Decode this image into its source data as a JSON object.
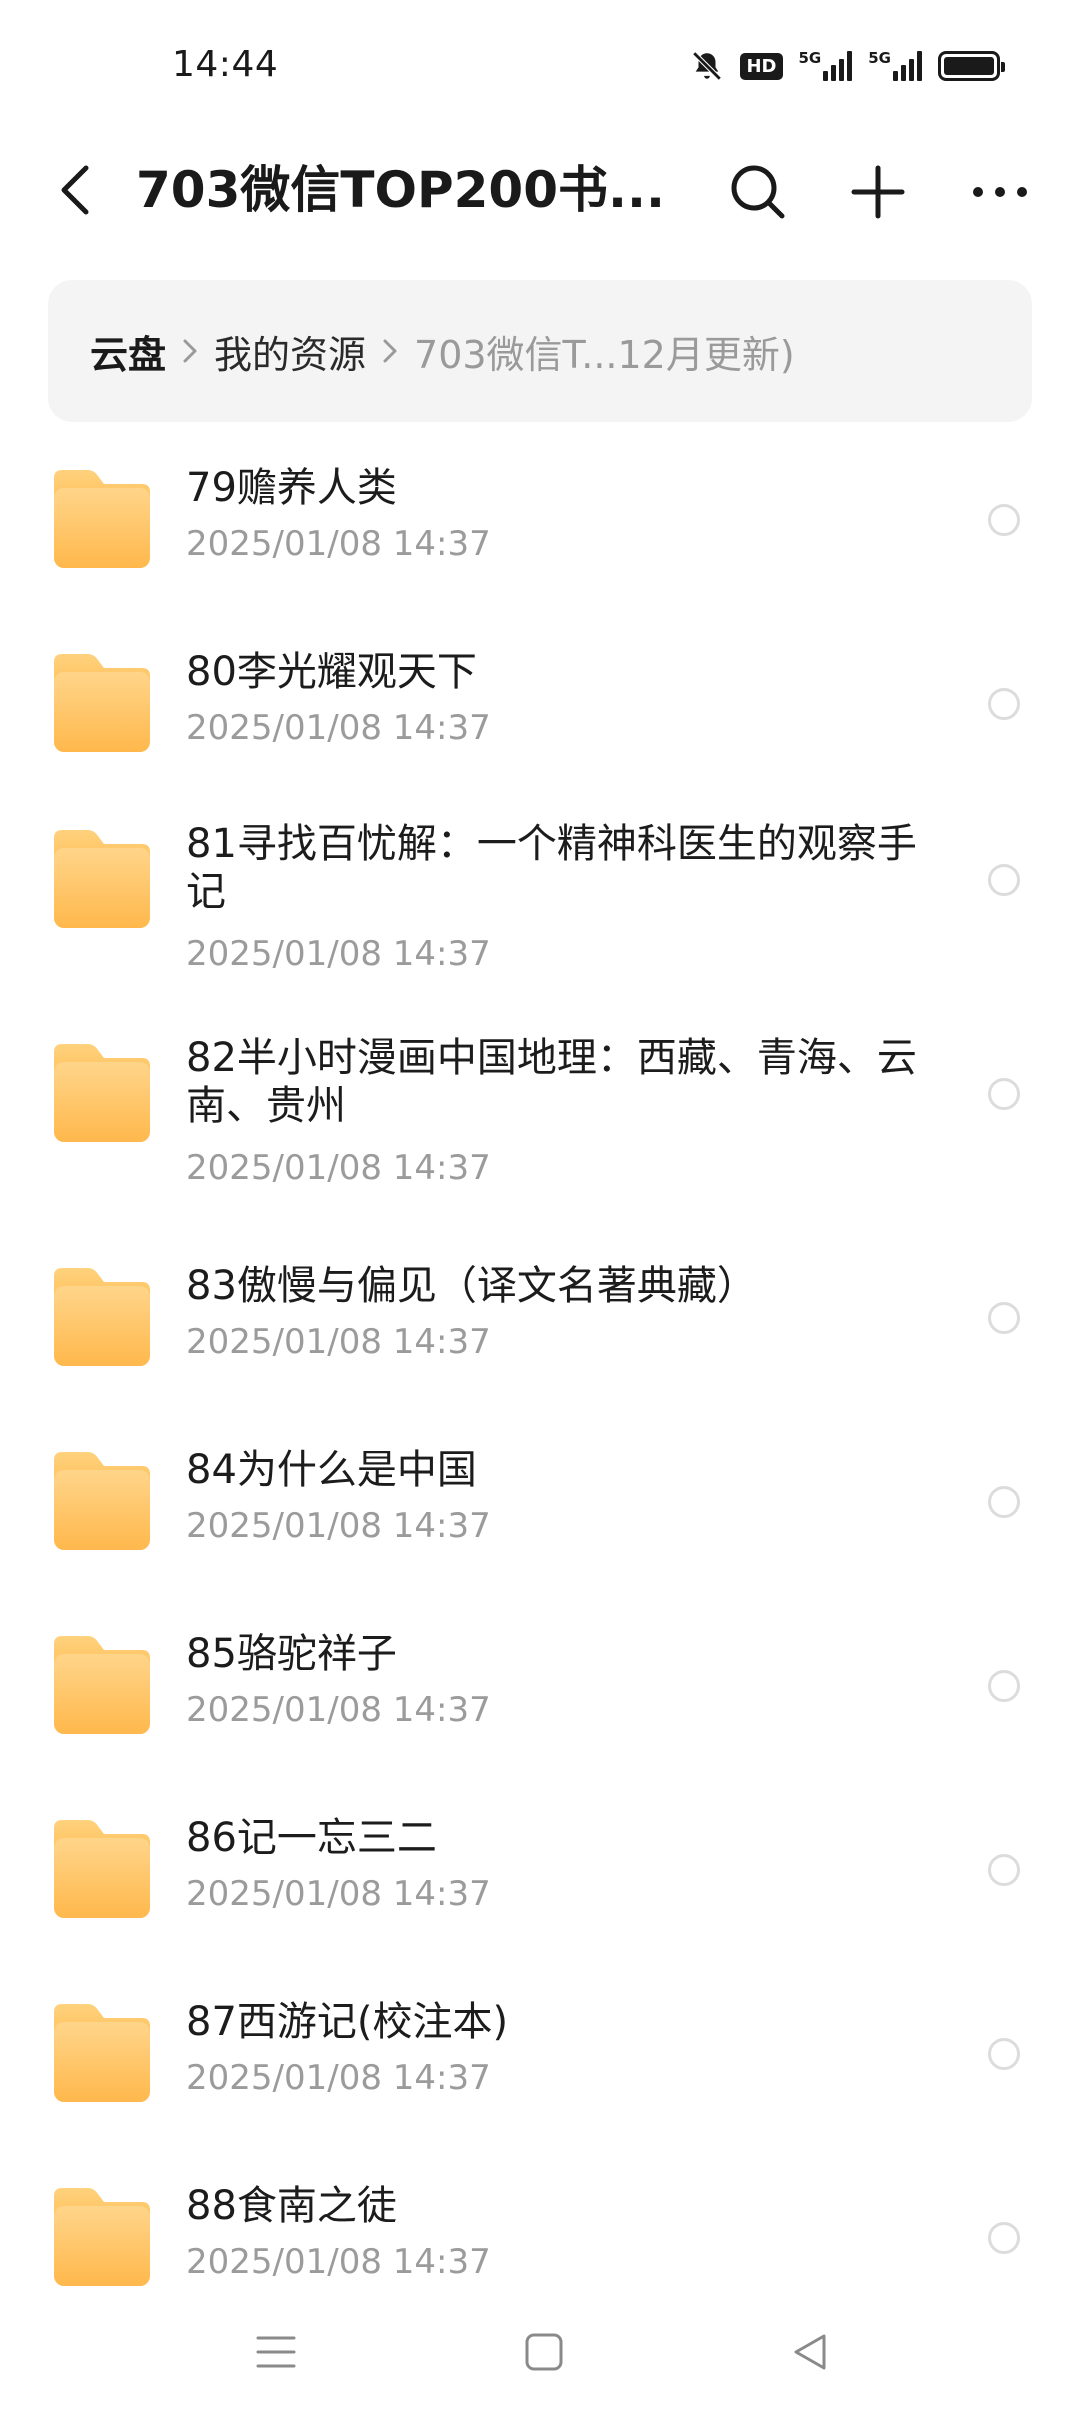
{
  "status_bar": {
    "time": "14:44",
    "icons": [
      "bell-muted-icon",
      "hd-icon",
      "signal-5g-icon",
      "signal-5g-icon",
      "battery-icon"
    ],
    "hd_label": "HD",
    "net1_label": "5G",
    "net2_label": "5G"
  },
  "header": {
    "title": "703微信TOP200书...",
    "back_icon": "chevron-left-icon",
    "search_icon": "search-icon",
    "add_icon": "plus-icon",
    "more_icon": "more-horizontal-icon"
  },
  "breadcrumb": {
    "root": "云盘",
    "mid": "我的资源",
    "current": "703微信T...12月更新)"
  },
  "files": [
    {
      "name": "79赡养人类",
      "date": "2025/01/08 14:37"
    },
    {
      "name": "80李光耀观天下",
      "date": "2025/01/08 14:37"
    },
    {
      "name": "81寻找百忧解：一个精神科医生的观察手记",
      "date": "2025/01/08 14:37"
    },
    {
      "name": "82半小时漫画中国地理：西藏、青海、云南、贵州",
      "date": "2025/01/08 14:37"
    },
    {
      "name": "83傲慢与偏见（译文名著典藏）",
      "date": "2025/01/08 14:37"
    },
    {
      "name": "84为什么是中国",
      "date": "2025/01/08 14:37"
    },
    {
      "name": "85骆驼祥子",
      "date": "2025/01/08 14:37"
    },
    {
      "name": "86记一忘三二",
      "date": "2025/01/08 14:37"
    },
    {
      "name": "87西游记(校注本)",
      "date": "2025/01/08 14:37"
    },
    {
      "name": "88食南之徒",
      "date": "2025/01/08 14:37"
    }
  ],
  "colors": {
    "folder_top": "#FFD58A",
    "folder_bottom": "#FFB84C",
    "text_secondary": "#9b9b9b"
  },
  "nav": {
    "menu_icon": "menu-icon",
    "home_icon": "square-home-icon",
    "back_icon": "triangle-back-icon"
  }
}
